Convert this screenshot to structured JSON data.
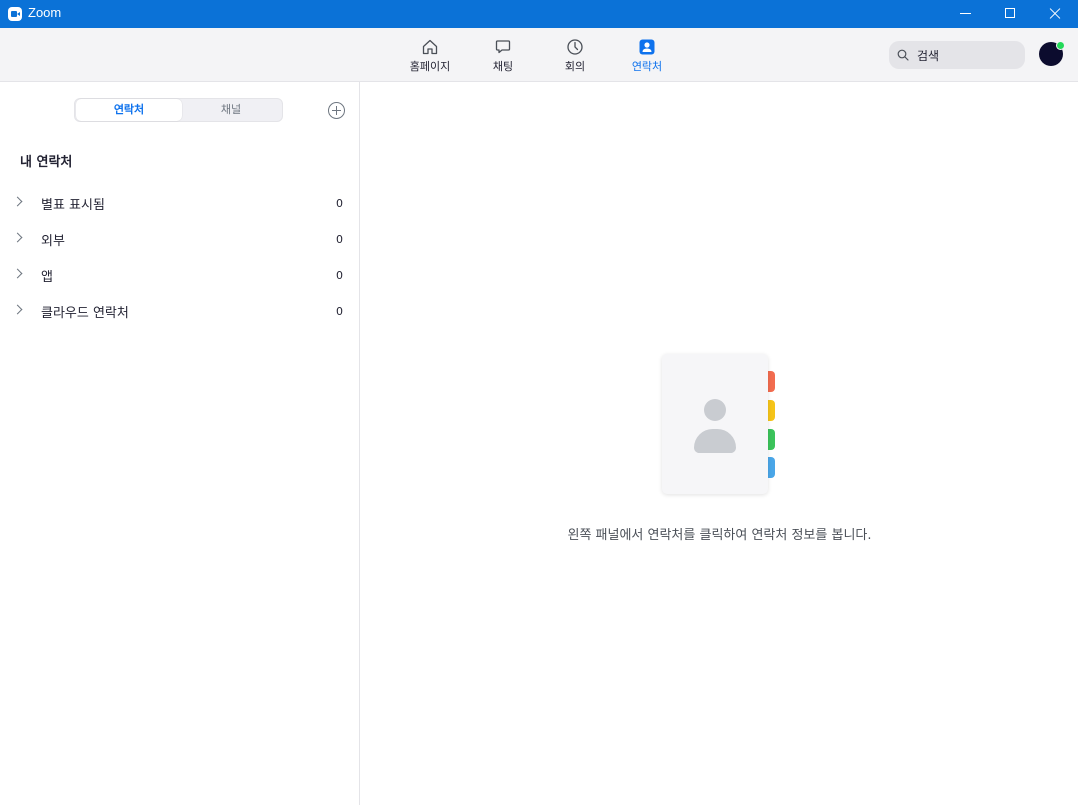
{
  "window": {
    "title": "Zoom"
  },
  "nav": {
    "home": "홈페이지",
    "chat": "채팅",
    "meetings": "회의",
    "contacts": "연락처"
  },
  "search": {
    "text": "검색"
  },
  "colors": {
    "titlebar": "#0b72d7",
    "accent": "#0e72ed",
    "presence": "#23d959"
  },
  "left": {
    "tabs": [
      "연락처",
      "채널"
    ],
    "section_title": "내 연락처",
    "groups": [
      {
        "label": "별표 표시됨",
        "count": "0"
      },
      {
        "label": "외부",
        "count": "0"
      },
      {
        "label": "앱",
        "count": "0"
      },
      {
        "label": "클라우드 연락처",
        "count": "0"
      }
    ]
  },
  "right": {
    "empty_message": "왼쪽 패널에서 연락처를 클릭하여 연락처 정보를 봅니다."
  }
}
